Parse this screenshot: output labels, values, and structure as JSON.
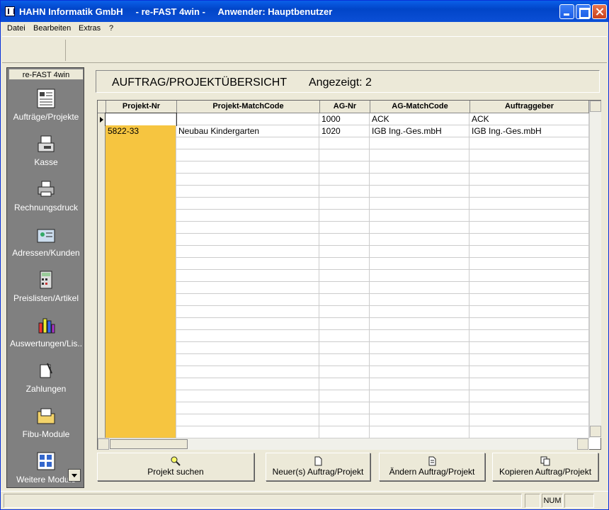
{
  "window": {
    "title": "HAHN Informatik GmbH     - re-FAST 4win -     Anwender: Hauptbenutzer"
  },
  "menu": [
    "Datei",
    "Bearbeiten",
    "Extras",
    "?"
  ],
  "sidebar": {
    "title": "re-FAST 4win",
    "items": [
      {
        "label": "Aufträge/Projekte",
        "icon": "document-list-icon"
      },
      {
        "label": "Kasse",
        "icon": "cash-register-icon"
      },
      {
        "label": "Rechnungsdruck",
        "icon": "printer-icon"
      },
      {
        "label": "Adressen/Kunden",
        "icon": "address-card-icon"
      },
      {
        "label": "Preislisten/Artikel",
        "icon": "calculator-icon"
      },
      {
        "label": "Auswertungen/Lis..",
        "icon": "bar-chart-icon"
      },
      {
        "label": "Zahlungen",
        "icon": "payment-icon"
      },
      {
        "label": "Fibu-Module",
        "icon": "folder-icon"
      },
      {
        "label": "Weitere Module",
        "icon": "modules-icon"
      }
    ]
  },
  "header": {
    "title": "AUFTRAG/PROJEKTÜBERSICHT",
    "count": "Angezeigt: 2"
  },
  "grid": {
    "columns": [
      "Projekt-Nr",
      "Projekt-MatchCode",
      "AG-Nr",
      "AG-MatchCode",
      "Auftraggeber"
    ],
    "rows": [
      [
        "",
        "",
        "1000",
        "ACK",
        "ACK"
      ],
      [
        "5822-33",
        "Neubau Kindergarten",
        "1020",
        "IGB Ing.-Ges.mbH",
        "IGB Ing.-Ges.mbH"
      ]
    ]
  },
  "buttons": {
    "search": "Projekt suchen",
    "new": "Neuer(s) Auftrag/Projekt",
    "edit": "Ändern Auftrag/Projekt",
    "copy": "Kopieren Auftrag/Projekt"
  },
  "status": {
    "num": "NUM"
  },
  "colors": {
    "key_column": "#f6c540",
    "sidebar": "#808080",
    "titlebar": "#0145c8"
  }
}
